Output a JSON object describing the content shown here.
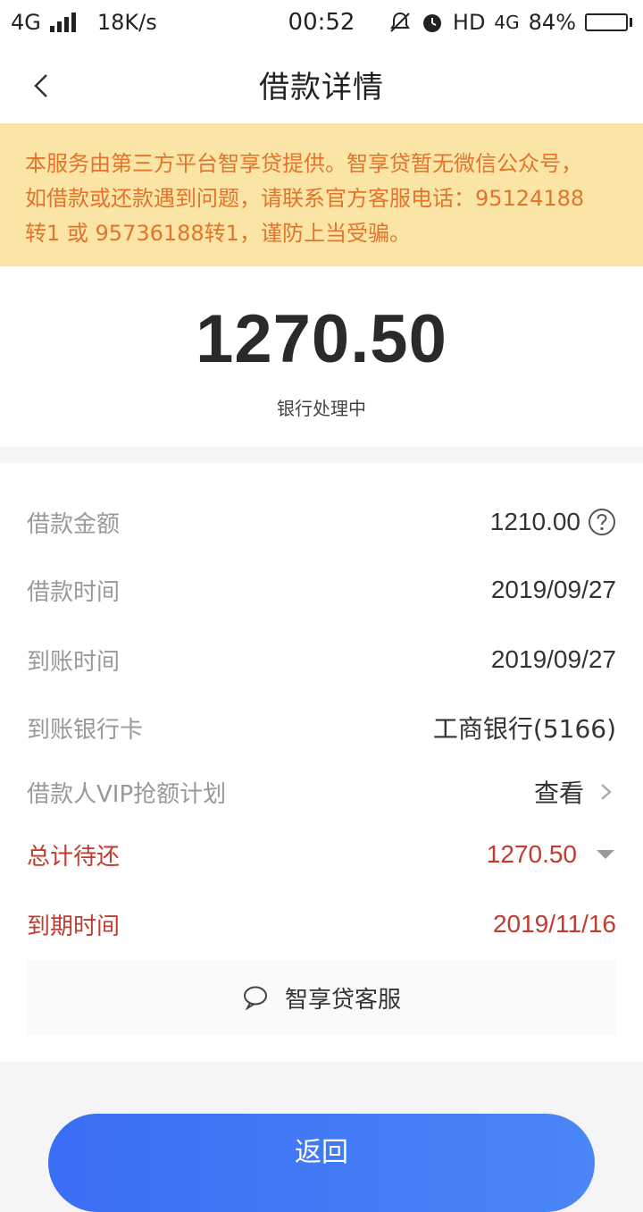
{
  "status_bar": {
    "network": "4G",
    "speed": "18K/s",
    "time": "00:52",
    "hd": "HD",
    "net2": "4G",
    "battery": "84%",
    "battery_level": 0.84
  },
  "nav": {
    "title": "借款详情"
  },
  "notice": {
    "lines": [
      "本服务由第三方平台智享贷提供。智享贷暂无微信公众号，",
      "如借款或还款遇到问题，请联系官方客服电话：95124188",
      "转1 或 95736188转1，谨防上当受骗。"
    ]
  },
  "summary": {
    "amount": "1270.50",
    "status": "银行处理中"
  },
  "details": {
    "rows": [
      {
        "label": "借款金额",
        "value": "1210.00"
      },
      {
        "label": "借款时间",
        "value": "2019/09/27"
      },
      {
        "label": "到账时间",
        "value": "2019/09/27"
      },
      {
        "label": "到账银行卡",
        "value": "工商银行(5166)"
      },
      {
        "label": "借款人VIP抢额计划",
        "value": "查看"
      },
      {
        "label": "总计待还",
        "value": "1270.50"
      },
      {
        "label": "到期时间",
        "value": "2019/11/16"
      }
    ]
  },
  "customer_service": {
    "label": "智享贷客服"
  },
  "footer": {
    "return_label": "返回"
  },
  "colors": {
    "accent_red": "#c33a2f",
    "notice_bg": "#fbe5a6",
    "notice_text": "#e2742b",
    "button_blue": "#3a6ef5"
  }
}
